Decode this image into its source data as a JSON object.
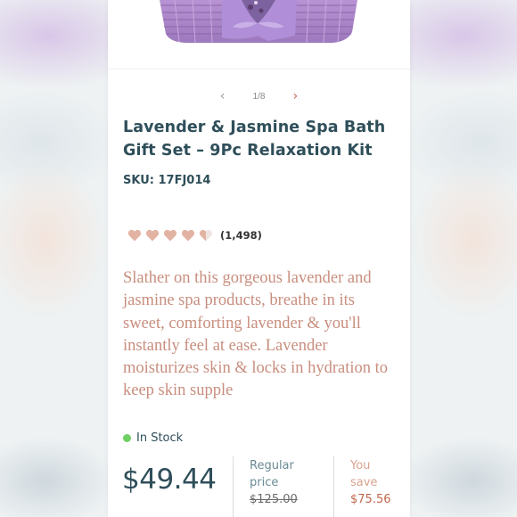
{
  "carousel": {
    "counter": "1/8"
  },
  "product": {
    "title": "Lavender & Jasmine Spa Bath Gift Set – 9Pc Relaxation Kit",
    "sku": "SKU: 17FJ014",
    "rating_value": 4.5,
    "rating_max": 5,
    "review_count": "(1,498)",
    "description": "Slather on this gorgeous lavender and jasmine spa products, breathe in its sweet, comforting lavender & you'll instantly feel at ease. Lavender moisturizes skin & locks in hydration to keep skin supple",
    "stock_status": "In Stock",
    "price": "$49.44",
    "regular_label_1": "Regular",
    "regular_label_2": "price",
    "regular_price": "$125.00",
    "save_label_1": "You",
    "save_label_2": "save",
    "save_amount": "$75.56"
  },
  "icons": {
    "prev": "chevron-left-icon",
    "next": "chevron-right-icon",
    "rating": "heart-icon",
    "stock": "status-dot-icon"
  },
  "colors": {
    "heading": "#2f4f5a",
    "description": "#c88e7e",
    "heart_full": "#e2b3a3",
    "heart_empty": "#eee4e1",
    "in_stock": "#6fcf63",
    "accent": "#c0664a"
  }
}
